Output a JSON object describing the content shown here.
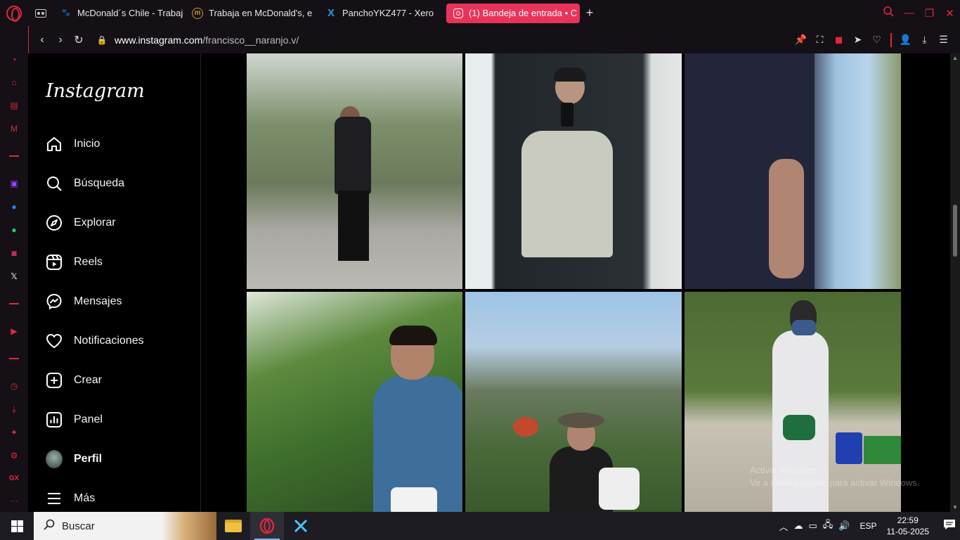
{
  "browser": {
    "tabs": [
      {
        "title": "McDonald´s Chile - Trabaj",
        "favicon": "paw-icon",
        "favicon_color": "#2a5bd7"
      },
      {
        "title": "Trabaja en McDonald's, e",
        "favicon": "mcdonalds-icon",
        "favicon_color": "#c89a2c"
      },
      {
        "title": "PanchoYKZ477 - Xero",
        "favicon": "x-icon",
        "favicon_color": "#1d9bf0"
      },
      {
        "title": "(1) Bandeja de entrada • C",
        "favicon": "instagram-icon",
        "favicon_color": "#e8335a",
        "active": true
      }
    ],
    "new_tab_label": "+",
    "url_domain": "www.instagram.com",
    "url_path": "/francisco__naranjo.v/"
  },
  "instagram": {
    "logo": "Instagram",
    "nav": [
      {
        "label": "Inicio",
        "icon": "home-icon"
      },
      {
        "label": "Búsqueda",
        "icon": "search-icon"
      },
      {
        "label": "Explorar",
        "icon": "compass-icon"
      },
      {
        "label": "Reels",
        "icon": "reels-icon"
      },
      {
        "label": "Mensajes",
        "icon": "messenger-icon"
      },
      {
        "label": "Notificaciones",
        "icon": "heart-icon"
      },
      {
        "label": "Crear",
        "icon": "plus-square-icon"
      },
      {
        "label": "Panel",
        "icon": "bar-chart-icon"
      },
      {
        "label": "Perfil",
        "icon": "avatar"
      },
      {
        "label": "Más",
        "icon": "menu-icon"
      }
    ]
  },
  "watermark": {
    "line1": "Activar Windows",
    "line2": "Ve a Configuración para activar Windows."
  },
  "taskbar": {
    "search_placeholder": "Buscar",
    "language": "ESP",
    "time": "22:59",
    "date": "11-05-2025"
  },
  "colors": {
    "opera_accent": "#e0283c",
    "active_tab": "#e8335a"
  }
}
